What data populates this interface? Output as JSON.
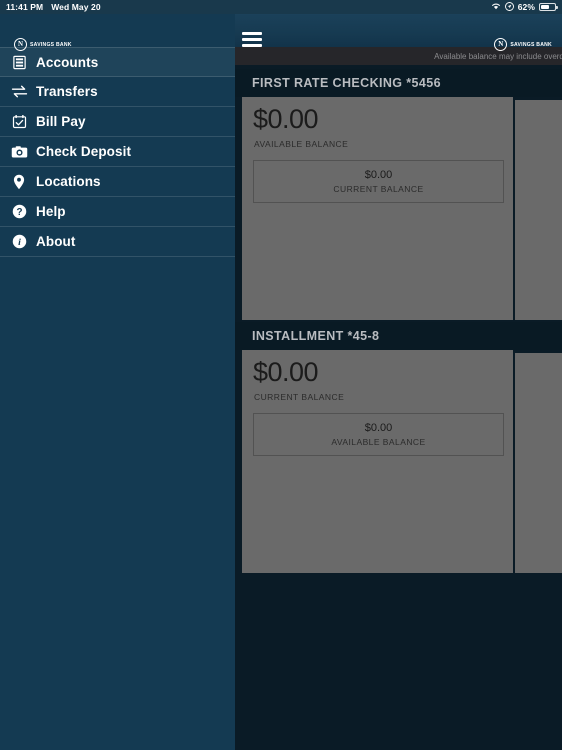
{
  "status_bar": {
    "time": "11:41 PM",
    "date": "Wed May 20",
    "wifi_icon": "wifi-icon",
    "location_icon": "location-services-icon",
    "battery_percent": "62%",
    "battery_icon": "battery-icon"
  },
  "header": {
    "menu_button_icon": "hamburger-menu-icon",
    "logo_monogram": "N",
    "logo_text": "SAVINGS BANK"
  },
  "sidebar": {
    "logo_monogram": "N",
    "logo_text": "SAVINGS BANK",
    "watermark": "",
    "items": [
      {
        "label": "Accounts",
        "icon": "bank-building-icon",
        "active": true
      },
      {
        "label": "Transfers",
        "icon": "transfer-arrows-icon",
        "active": false
      },
      {
        "label": "Bill Pay",
        "icon": "calendar-check-icon",
        "active": false
      },
      {
        "label": "Check Deposit",
        "icon": "camera-icon",
        "active": false
      },
      {
        "label": "Locations",
        "icon": "map-pin-icon",
        "active": false
      },
      {
        "label": "Help",
        "icon": "question-circle-icon",
        "active": false
      },
      {
        "label": "About",
        "icon": "info-circle-icon",
        "active": false
      }
    ]
  },
  "content": {
    "notice": "Available balance may include overdra",
    "accounts": [
      {
        "title": "FIRST RATE CHECKING *5456",
        "primary_amount": "$0.00",
        "primary_label": "AVAILABLE BALANCE",
        "secondary_amount": "$0.00",
        "secondary_label": "CURRENT BALANCE"
      },
      {
        "title": "INSTALLMENT *45-8",
        "primary_amount": "$0.00",
        "primary_label": "CURRENT BALANCE",
        "secondary_amount": "$0.00",
        "secondary_label": "AVAILABLE BALANCE"
      }
    ]
  },
  "colors": {
    "sidebar": "#143a52",
    "header": "#163a51",
    "background": "#0a1b26",
    "card_panel": "#6a6a6a",
    "notice_bar": "#26262a"
  }
}
